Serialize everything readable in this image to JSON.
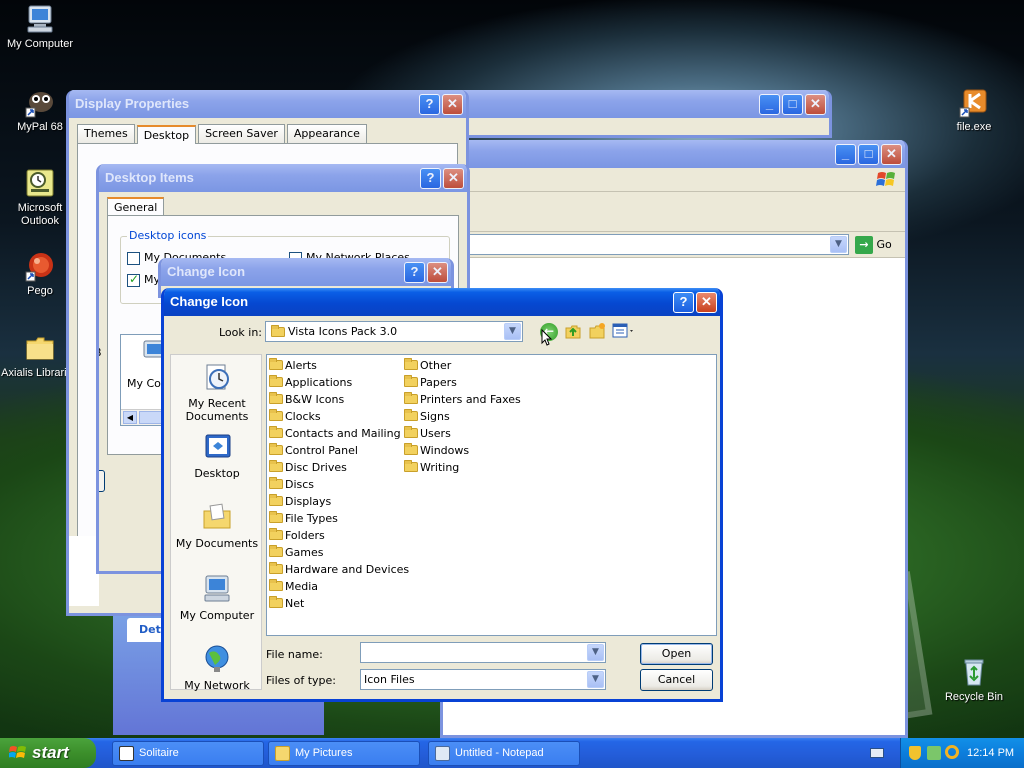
{
  "desktop": {
    "icons": [
      {
        "label": "My Computer"
      },
      {
        "label": "MyPal 68"
      },
      {
        "label": "Microsoft Outlook"
      },
      {
        "label": "Pego"
      },
      {
        "label": "Axialis Librarian"
      },
      {
        "label": "file.exe"
      },
      {
        "label": "Recycle Bin"
      }
    ]
  },
  "display_props": {
    "title": "Display Properties",
    "tabs": [
      "Themes",
      "Desktop",
      "Screen Saver",
      "Appearance"
    ],
    "active_tab": "Desktop",
    "detail_fragment": "Det"
  },
  "desktop_items": {
    "title": "Desktop Items",
    "tab": "General",
    "group_label": "Desktop icons",
    "checks": [
      {
        "label": "My Documents",
        "checked": false
      },
      {
        "label": "My Network Places",
        "checked": false
      },
      {
        "label": "My",
        "checked": true
      }
    ],
    "partial_letter": "B",
    "list_fragment": "My Co"
  },
  "change_icon_back": {
    "title": "Change Icon"
  },
  "change_icon": {
    "title": "Change Icon",
    "look_in_label": "Look in:",
    "look_in_value": "Vista Icons Pack 3.0",
    "places": [
      "My Recent Documents",
      "Desktop",
      "My Documents",
      "My Computer",
      "My Network"
    ],
    "folders_col1": [
      "Alerts",
      "Applications",
      "B&W Icons",
      "Clocks",
      "Contacts and Mailing",
      "Control Panel",
      "Disc Drives",
      "Discs",
      "Displays",
      "File Types",
      "Folders",
      "Games",
      "Hardware and Devices",
      "Media",
      "Net"
    ],
    "folders_col2": [
      "Other",
      "Papers",
      "Printers and Faxes",
      "Signs",
      "Users",
      "Windows",
      "Writing"
    ],
    "file_name_label": "File name:",
    "file_name_value": "",
    "file_type_label": "Files of type:",
    "file_type_value": "Icon Files",
    "open_label": "Open",
    "cancel_label": "Cancel"
  },
  "explorer": {
    "go_label": "Go"
  },
  "taskbar": {
    "start_label": "start",
    "tasks": [
      "Solitaire",
      "My Pictures",
      "Untitled - Notepad"
    ],
    "clock": "12:14 PM"
  },
  "colors": {
    "xp_blue": "#0648d1",
    "start_green": "#3c8f2b",
    "tray_blue": "#0c7edc"
  }
}
